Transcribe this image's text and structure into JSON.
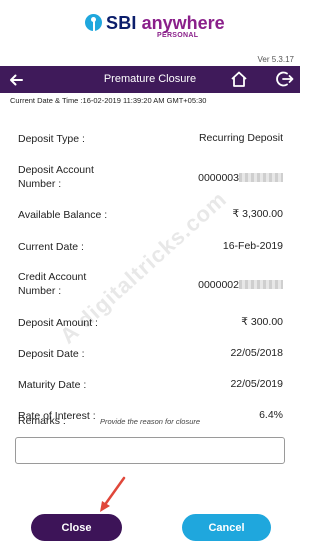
{
  "brand": {
    "name_sbi": "SBI",
    "name_anywhere": "anywhere",
    "sub": "PERSONAL"
  },
  "version": "Ver 5.3.17",
  "nav": {
    "title": "Premature Closure"
  },
  "datetime": "Current Date & Time :16-02-2019 11:39:20 AM GMT+05:30",
  "fields": {
    "deposit_type": {
      "label": "Deposit Type :",
      "value": "Recurring Deposit"
    },
    "deposit_account": {
      "label": "Deposit Account Number :",
      "value": "0000003"
    },
    "available_balance": {
      "label": "Available Balance :",
      "value": "₹ 3,300.00"
    },
    "current_date": {
      "label": "Current Date :",
      "value": "16-Feb-2019"
    },
    "credit_account": {
      "label": "Credit Account Number :",
      "value": "0000002"
    },
    "deposit_amount": {
      "label": "Deposit Amount :",
      "value": "₹ 300.00"
    },
    "deposit_date": {
      "label": "Deposit Date :",
      "value": "22/05/2018"
    },
    "maturity_date": {
      "label": "Maturity Date :",
      "value": "22/05/2019"
    },
    "rate_of_interest": {
      "label": "Rate of Interest :",
      "value": "6.4%"
    }
  },
  "remarks": {
    "label": "Remarks :",
    "hint": "Provide the reason for closure",
    "value": ""
  },
  "buttons": {
    "close": "Close",
    "cancel": "Cancel"
  },
  "watermark": "A digitaltricks.com",
  "colors": {
    "navbar": "#3f1a5a",
    "close_button": "#3d1458",
    "cancel_button": "#1fa7dd",
    "arrow": "#e0473a"
  }
}
